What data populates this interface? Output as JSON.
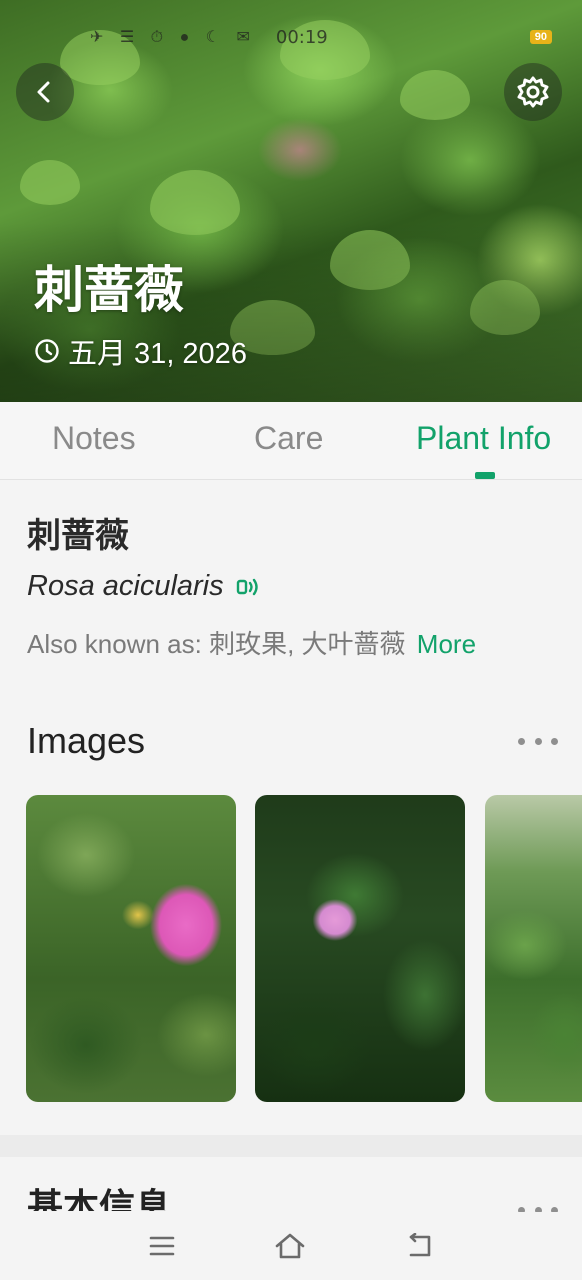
{
  "status_bar": {
    "time": "00:19",
    "battery": "90"
  },
  "hero": {
    "title": "刺蔷薇",
    "date": "五月 31, 2026"
  },
  "tabs": [
    {
      "label": "Notes",
      "active": false
    },
    {
      "label": "Care",
      "active": false
    },
    {
      "label": "Plant Info",
      "active": true
    }
  ],
  "plant": {
    "name": "刺蔷薇",
    "latin_name": "Rosa acicularis",
    "aka_label": "Also known as:",
    "aka_values": "刺玫果, 大叶蔷薇",
    "more_label": "More"
  },
  "images_section": {
    "title": "Images"
  },
  "basic_section": {
    "title": "基本信息"
  },
  "colors": {
    "accent": "#12a26a",
    "battery": "#e7b319"
  },
  "icons": [
    "back-arrow-icon",
    "gear-icon",
    "clock-icon",
    "speaker-icon",
    "menu-icon",
    "home-icon",
    "return-icon"
  ]
}
